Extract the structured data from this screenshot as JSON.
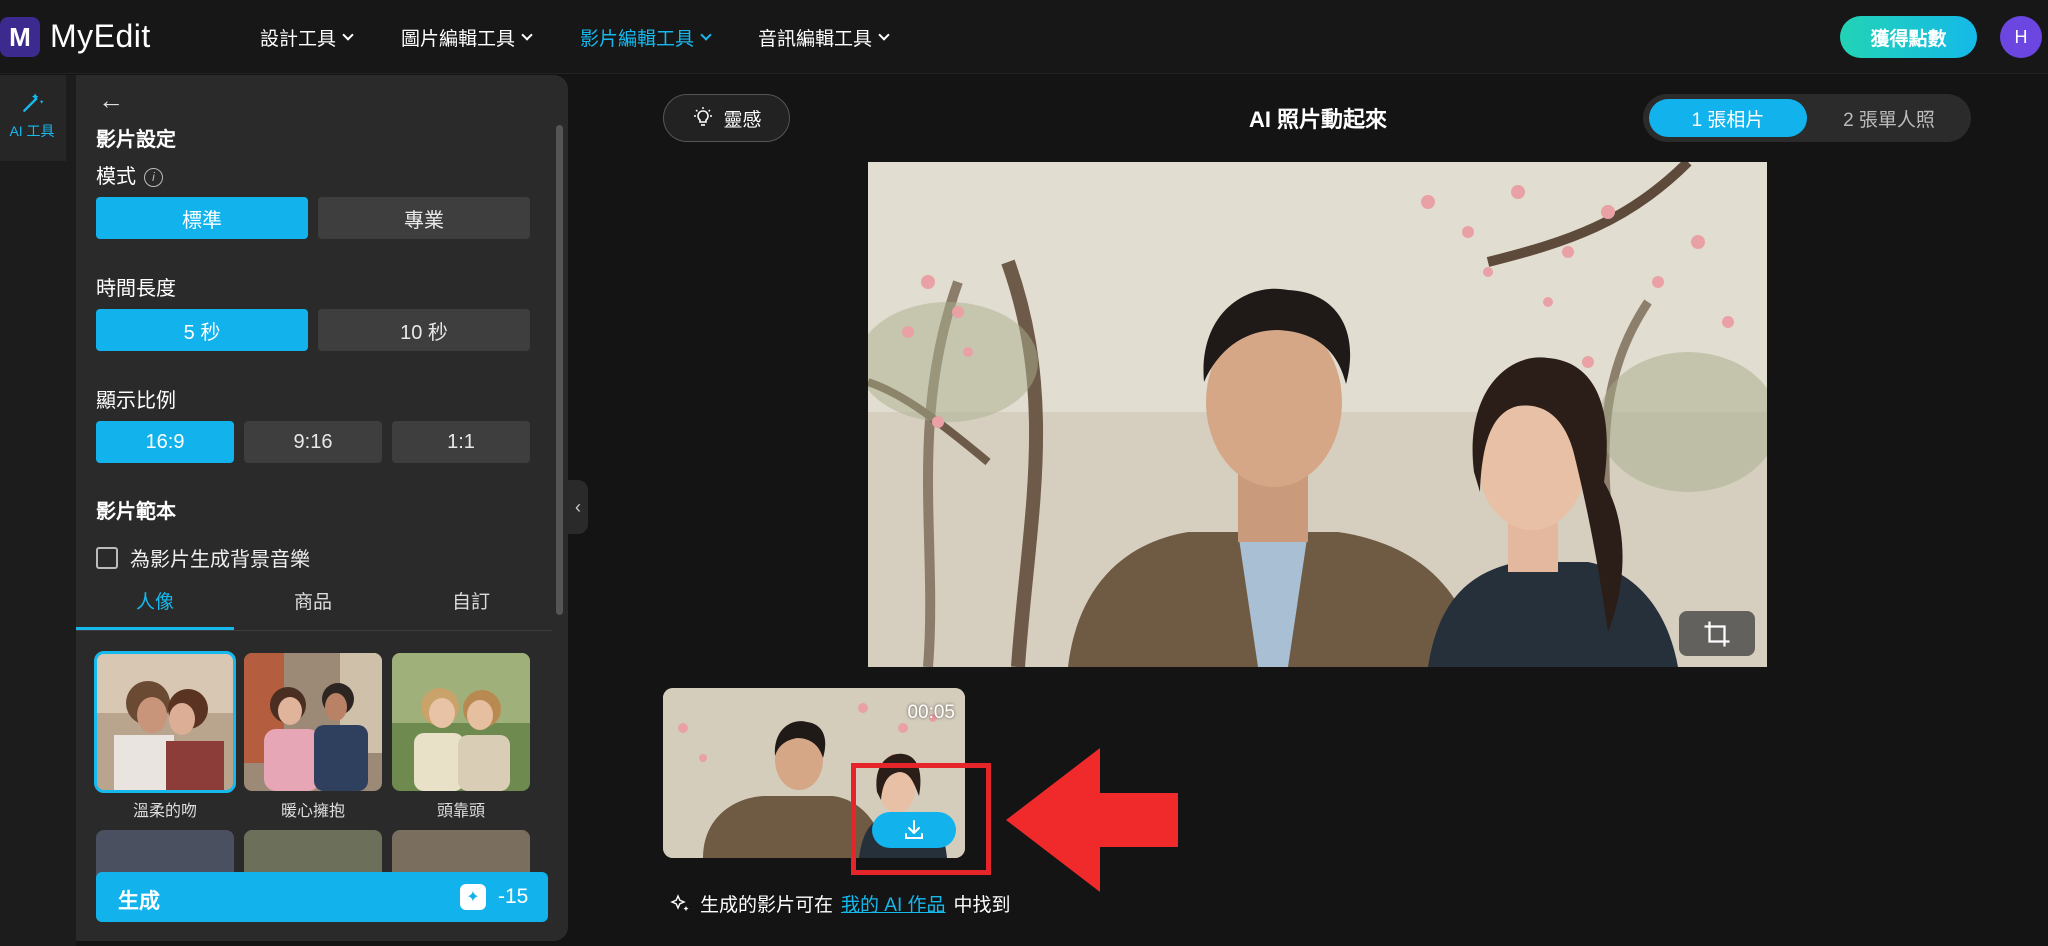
{
  "brand": {
    "logo_letter": "M",
    "name": "MyEdit"
  },
  "nav": {
    "items": [
      {
        "label": "設計工具"
      },
      {
        "label": "圖片編輯工具"
      },
      {
        "label": "影片編輯工具",
        "active": true
      },
      {
        "label": "音訊編輯工具"
      }
    ],
    "points_button": "獲得點數",
    "avatar_letter": "H"
  },
  "rail": {
    "ai_tools_label": "AI 工具"
  },
  "panel": {
    "title": "影片設定",
    "mode": {
      "label": "模式",
      "options": [
        "標準",
        "專業"
      ],
      "selected": "標準"
    },
    "duration": {
      "label": "時間長度",
      "options": [
        "5 秒",
        "10 秒"
      ],
      "selected": "5 秒"
    },
    "ratio": {
      "label": "顯示比例",
      "options": [
        "16:9",
        "9:16",
        "1:1"
      ],
      "selected": "16:9"
    },
    "template": {
      "title": "影片範本",
      "bg_music_label": "為影片生成背景音樂",
      "bg_music_checked": false,
      "tabs": [
        "人像",
        "商品",
        "自訂"
      ],
      "active_tab": "人像",
      "items": [
        {
          "label": "溫柔的吻",
          "selected": true
        },
        {
          "label": "暖心擁抱",
          "selected": false
        },
        {
          "label": "頭靠頭",
          "selected": false
        }
      ]
    },
    "generate_button": "生成",
    "generate_cost": "-15"
  },
  "main": {
    "inspire_button": "靈感",
    "title": "AI 照片動起來",
    "mode_toggle": {
      "options": [
        "1 張相片",
        "2 張單人照"
      ],
      "selected": "1 張相片"
    },
    "result": {
      "duration": "00:05"
    },
    "footer": {
      "prefix": "生成的影片可在",
      "link": "我的 AI 作品",
      "suffix": "中找到"
    }
  },
  "colors": {
    "accent": "#12b3ec",
    "highlight": "#e5252a",
    "background": "#141414"
  }
}
